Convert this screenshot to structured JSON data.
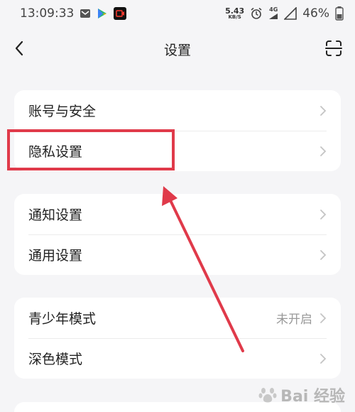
{
  "status_bar": {
    "time": "13:09:33",
    "net_speed_value": "5.43",
    "net_speed_unit": "KB/S",
    "network_type": "4G",
    "battery": "46%",
    "icons": [
      "mail-icon",
      "play-store-icon",
      "video-app-icon",
      "alarm-icon",
      "signal-icon",
      "battery-icon"
    ]
  },
  "nav": {
    "title": "设置",
    "icons": [
      "back-icon",
      "scan-icon"
    ]
  },
  "sections": [
    {
      "items": [
        {
          "label": "账号与安全",
          "value": ""
        },
        {
          "label": "隐私设置",
          "value": ""
        }
      ]
    },
    {
      "items": [
        {
          "label": "通知设置",
          "value": ""
        },
        {
          "label": "通用设置",
          "value": ""
        }
      ]
    },
    {
      "items": [
        {
          "label": "青少年模式",
          "value": "未开启"
        },
        {
          "label": "深色模式",
          "value": ""
        }
      ]
    }
  ],
  "annotation": {
    "color": "#e03a4a",
    "target": "隐私设置"
  },
  "watermark": {
    "text": "Bai 经验",
    "icon": "baidu-paw-icon"
  },
  "colors": {
    "background": "#f5f5f7",
    "card": "#ffffff",
    "secondary_text": "#999999"
  }
}
